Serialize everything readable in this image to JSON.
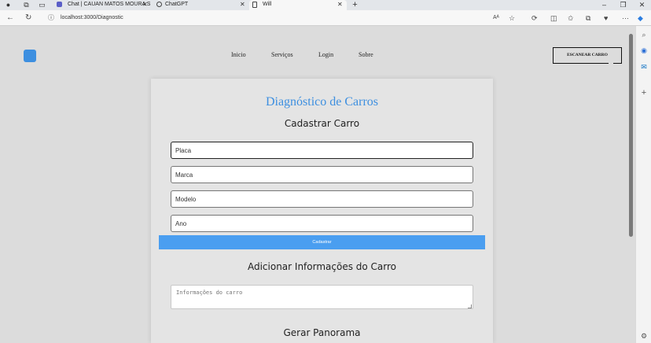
{
  "browser": {
    "tabs": [
      {
        "label": "Chat | CAUAN MATOS MOURA S",
        "icon": "teams-icon"
      },
      {
        "label": "ChatGPT",
        "icon": "chatgpt-icon"
      },
      {
        "label": "Will",
        "icon": "document-icon"
      }
    ],
    "url": "localhost:3000/Diagnostic",
    "window_controls": {
      "minimize": "–",
      "restore": "❐",
      "close": "✕"
    }
  },
  "site": {
    "nav": {
      "inicio": "Inicio",
      "servicos": "Serviços",
      "login": "Login",
      "sobre": "Sobre"
    },
    "scan_button": "ESCANEAR CARRO"
  },
  "form": {
    "title": "Diagnóstico de Carros",
    "register_heading": "Cadastrar Carro",
    "placa_placeholder": "Placa",
    "marca_placeholder": "Marca",
    "modelo_placeholder": "Modelo",
    "ano_placeholder": "Ano",
    "submit_label": "Cadastrar",
    "info_heading": "Adicionar Informações do Carro",
    "info_placeholder": "Informações do carro",
    "panorama_heading": "Gerar Panorama"
  },
  "colors": {
    "accent": "#3d8fe0",
    "button": "#4a9ef0",
    "page_bg": "#dcdcdc",
    "card_bg": "#e4e4e4"
  }
}
